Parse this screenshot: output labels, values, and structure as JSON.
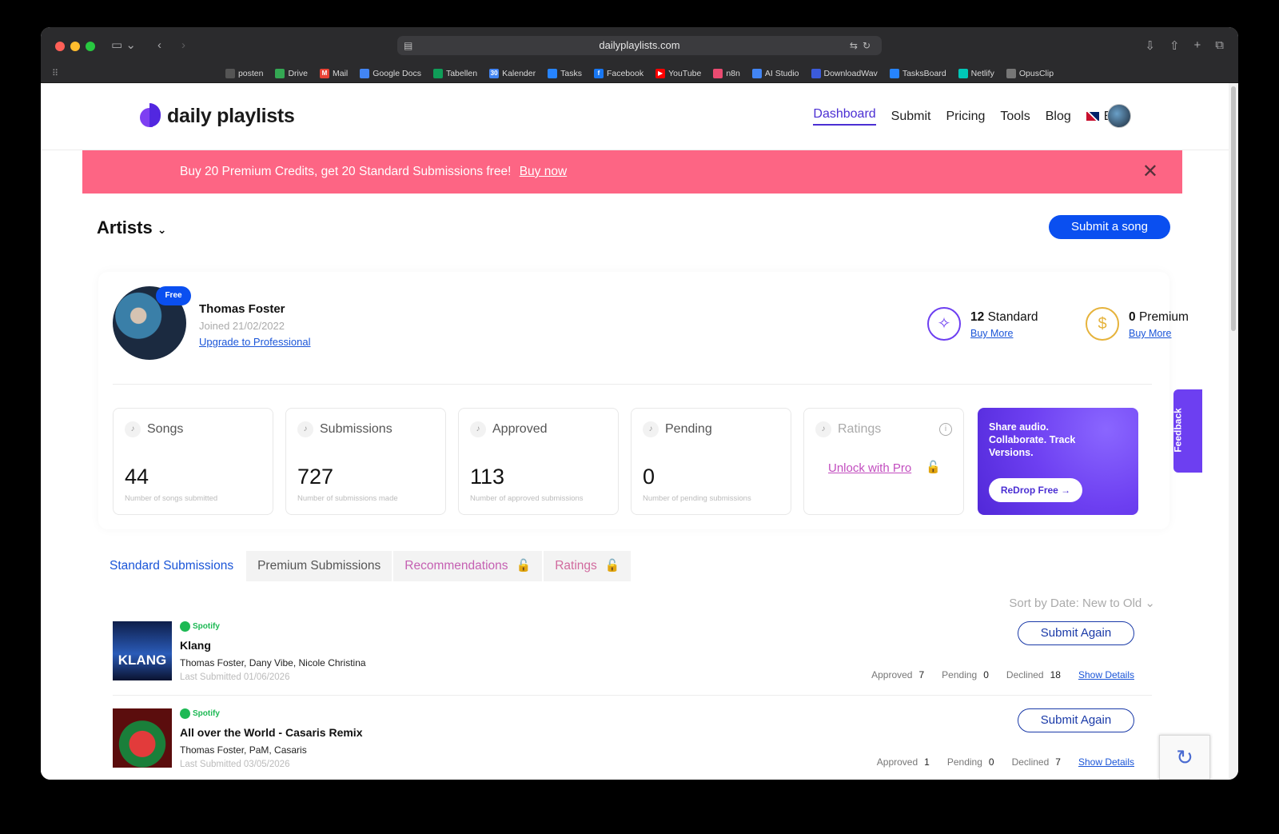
{
  "browser": {
    "url": "dailyplaylists.com",
    "bookmarks": [
      {
        "label": "posten",
        "color": "#555555"
      },
      {
        "label": "Drive",
        "color": "#34a853"
      },
      {
        "label": "Mail",
        "color": "#ea4335"
      },
      {
        "label": "Google Docs",
        "color": "#4285f4"
      },
      {
        "label": "Tabellen",
        "color": "#0f9d58"
      },
      {
        "label": "Kalender",
        "color": "#4285f4"
      },
      {
        "label": "Tasks",
        "color": "#2684ff"
      },
      {
        "label": "Facebook",
        "color": "#1877f2"
      },
      {
        "label": "YouTube",
        "color": "#ff0000"
      },
      {
        "label": "n8n",
        "color": "#ea4b71"
      },
      {
        "label": "AI Studio",
        "color": "#4285f4"
      },
      {
        "label": "DownloadWav",
        "color": "#3b5bdb"
      },
      {
        "label": "TasksBoard",
        "color": "#2684ff"
      },
      {
        "label": "Netlify",
        "color": "#00c7b7"
      },
      {
        "label": "OpusClip",
        "color": "#cccccc"
      }
    ]
  },
  "nav": {
    "logo": "daily playlists",
    "links": [
      "Dashboard",
      "Submit",
      "Pricing",
      "Tools",
      "Blog"
    ],
    "language": "EN"
  },
  "banner": {
    "text": "Buy 20 Premium Credits, get 20 Standard Submissions free!",
    "link": "Buy now",
    "close": "✕"
  },
  "header": {
    "title": "Artists",
    "submit_button": "Submit a song"
  },
  "profile": {
    "badge": "Free",
    "name": "Thomas Foster",
    "joined": "Joined 21/02/2022",
    "upgrade_link": "Upgrade to Professional",
    "standard": {
      "count": "12",
      "label": "Standard",
      "link": "Buy More"
    },
    "premium": {
      "count": "0",
      "label": "Premium",
      "link": "Buy More"
    }
  },
  "stats": [
    {
      "label": "Songs",
      "value": "44",
      "sub": "Number of songs submitted"
    },
    {
      "label": "Submissions",
      "value": "727",
      "sub": "Number of submissions made"
    },
    {
      "label": "Approved",
      "value": "113",
      "sub": "Number of approved submissions"
    },
    {
      "label": "Pending",
      "value": "0",
      "sub": "Number of pending submissions"
    }
  ],
  "ratings_card": {
    "label": "Ratings",
    "unlock": "Unlock with Pro"
  },
  "promo": {
    "text": "Share audio. Collaborate. Track Versions.",
    "button": "ReDrop Free →"
  },
  "tabs": [
    "Standard Submissions",
    "Premium Submissions",
    "Recommendations",
    "Ratings"
  ],
  "sort": "Sort by Date: New to Old",
  "songs": [
    {
      "platform": "Spotify",
      "cover_text": "KLANG",
      "title": "Klang",
      "artists": "Thomas Foster, Dany Vibe, Nicole Christina",
      "last_submitted": "Last Submitted 01/06/2026",
      "button": "Submit Again",
      "approved_label": "Approved",
      "approved": "7",
      "pending_label": "Pending",
      "pending": "0",
      "declined_label": "Declined",
      "declined": "18",
      "details": "Show Details"
    },
    {
      "platform": "Spotify",
      "title": "All over the World - Casaris Remix",
      "artists": "Thomas Foster, PaM, Casaris",
      "last_submitted": "Last Submitted 03/05/2026",
      "button": "Submit Again",
      "approved_label": "Approved",
      "approved": "1",
      "pending_label": "Pending",
      "pending": "0",
      "declined_label": "Declined",
      "declined": "7",
      "details": "Show Details"
    }
  ],
  "feedback": "Feedback",
  "colors": {
    "accent": "#0a4ff0",
    "brand": "#6d3ff1",
    "banner": "#fd6584"
  }
}
